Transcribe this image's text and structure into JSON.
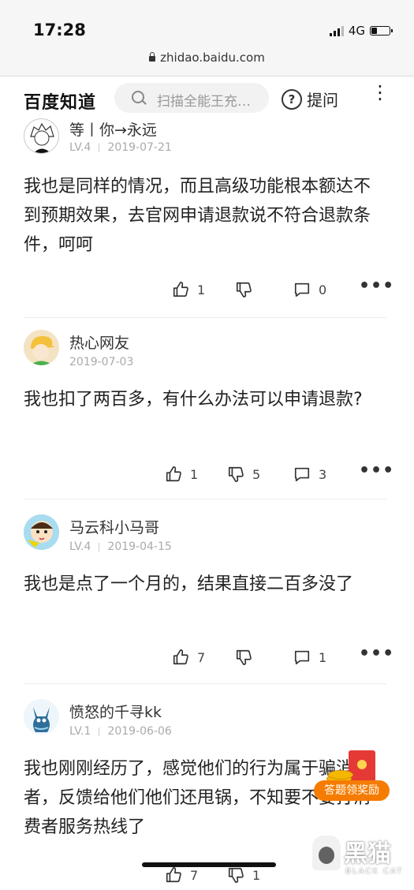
{
  "status_bar": {
    "time": "17:28",
    "network": "4G",
    "battery_level": 0.35
  },
  "browser": {
    "url": "zhidao.baidu.com"
  },
  "header": {
    "logo": "百度知道",
    "search_placeholder": "扫描全能王充…",
    "ask_label": "提问",
    "more_glyph": "⋮"
  },
  "answers": [
    {
      "username": "等丨你→永远",
      "level": "LV.4",
      "date": "2019-07-21",
      "content": "我也是同样的情况，而且高级功能根本额达不到预期效果，去官网申请退款说不符合退款条件，呵呵",
      "likes": "1",
      "dislikes": "",
      "comments": "0"
    },
    {
      "username": "热心网友",
      "level": "",
      "date": "2019-07-03",
      "content": "我也扣了两百多，有什么办法可以申请退款?",
      "likes": "1",
      "dislikes": "5",
      "comments": "3"
    },
    {
      "username": "马云科小马哥",
      "level": "LV.4",
      "date": "2019-04-15",
      "content": "我也是点了一个月的，结果直接二百多没了",
      "likes": "7",
      "dislikes": "",
      "comments": "1"
    },
    {
      "username": "愤怒的千寻kk",
      "level": "LV.1",
      "date": "2019-06-06",
      "content": "我也刚刚经历了，感觉他们的行为属于骗消费者，反馈给他们他们还甩锅，不知要不要打消费者服务热线了",
      "likes": "7",
      "dislikes": "1",
      "comments": ""
    }
  ],
  "reward_badge": {
    "label": "答题领奖励"
  },
  "watermark": {
    "text": "黑猫",
    "sub": "BLACK CAT"
  },
  "more_actions_glyph": "•••"
}
